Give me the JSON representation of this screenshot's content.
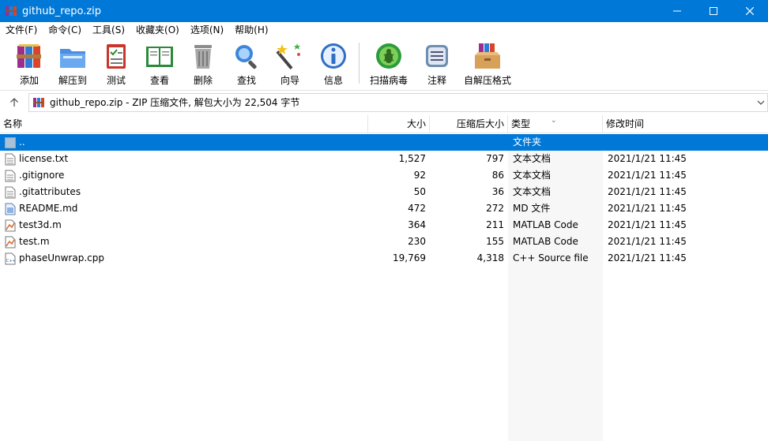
{
  "window": {
    "title": "github_repo.zip"
  },
  "menu": [
    {
      "label": "文件(F)"
    },
    {
      "label": "命令(C)"
    },
    {
      "label": "工具(S)"
    },
    {
      "label": "收藏夹(O)"
    },
    {
      "label": "选项(N)"
    },
    {
      "label": "帮助(H)"
    }
  ],
  "toolbar": {
    "add": "添加",
    "extract": "解压到",
    "test": "测试",
    "view": "查看",
    "delete": "删除",
    "find": "查找",
    "wizard": "向导",
    "info": "信息",
    "scan": "扫描病毒",
    "comment": "注释",
    "sfx": "自解压格式"
  },
  "address": {
    "text": "github_repo.zip - ZIP 压缩文件, 解包大小为 22,504 字节"
  },
  "columns": {
    "name": "名称",
    "size": "大小",
    "packed": "压缩后大小",
    "type": "类型",
    "modified": "修改时间"
  },
  "files": [
    {
      "name": "..",
      "size": "",
      "packed": "",
      "type": "文件夹",
      "modified": "",
      "icon": "folder-up-icon"
    },
    {
      "name": "license.txt",
      "size": "1,527",
      "packed": "797",
      "type": "文本文档",
      "modified": "2021/1/21 11:45",
      "icon": "text-file-icon"
    },
    {
      "name": ".gitignore",
      "size": "92",
      "packed": "86",
      "type": "文本文档",
      "modified": "2021/1/21 11:45",
      "icon": "text-file-icon"
    },
    {
      "name": ".gitattributes",
      "size": "50",
      "packed": "36",
      "type": "文本文档",
      "modified": "2021/1/21 11:45",
      "icon": "text-file-icon"
    },
    {
      "name": "README.md",
      "size": "472",
      "packed": "272",
      "type": "MD 文件",
      "modified": "2021/1/21 11:45",
      "icon": "md-file-icon"
    },
    {
      "name": "test3d.m",
      "size": "364",
      "packed": "211",
      "type": "MATLAB Code",
      "modified": "2021/1/21 11:45",
      "icon": "matlab-file-icon"
    },
    {
      "name": "test.m",
      "size": "230",
      "packed": "155",
      "type": "MATLAB Code",
      "modified": "2021/1/21 11:45",
      "icon": "matlab-file-icon"
    },
    {
      "name": "phaseUnwrap.cpp",
      "size": "19,769",
      "packed": "4,318",
      "type": "C++ Source file",
      "modified": "2021/1/21 11:45",
      "icon": "cpp-file-icon"
    }
  ],
  "colors": {
    "accent": "#0078d7",
    "type_column_bg": "#f7f7f7"
  }
}
